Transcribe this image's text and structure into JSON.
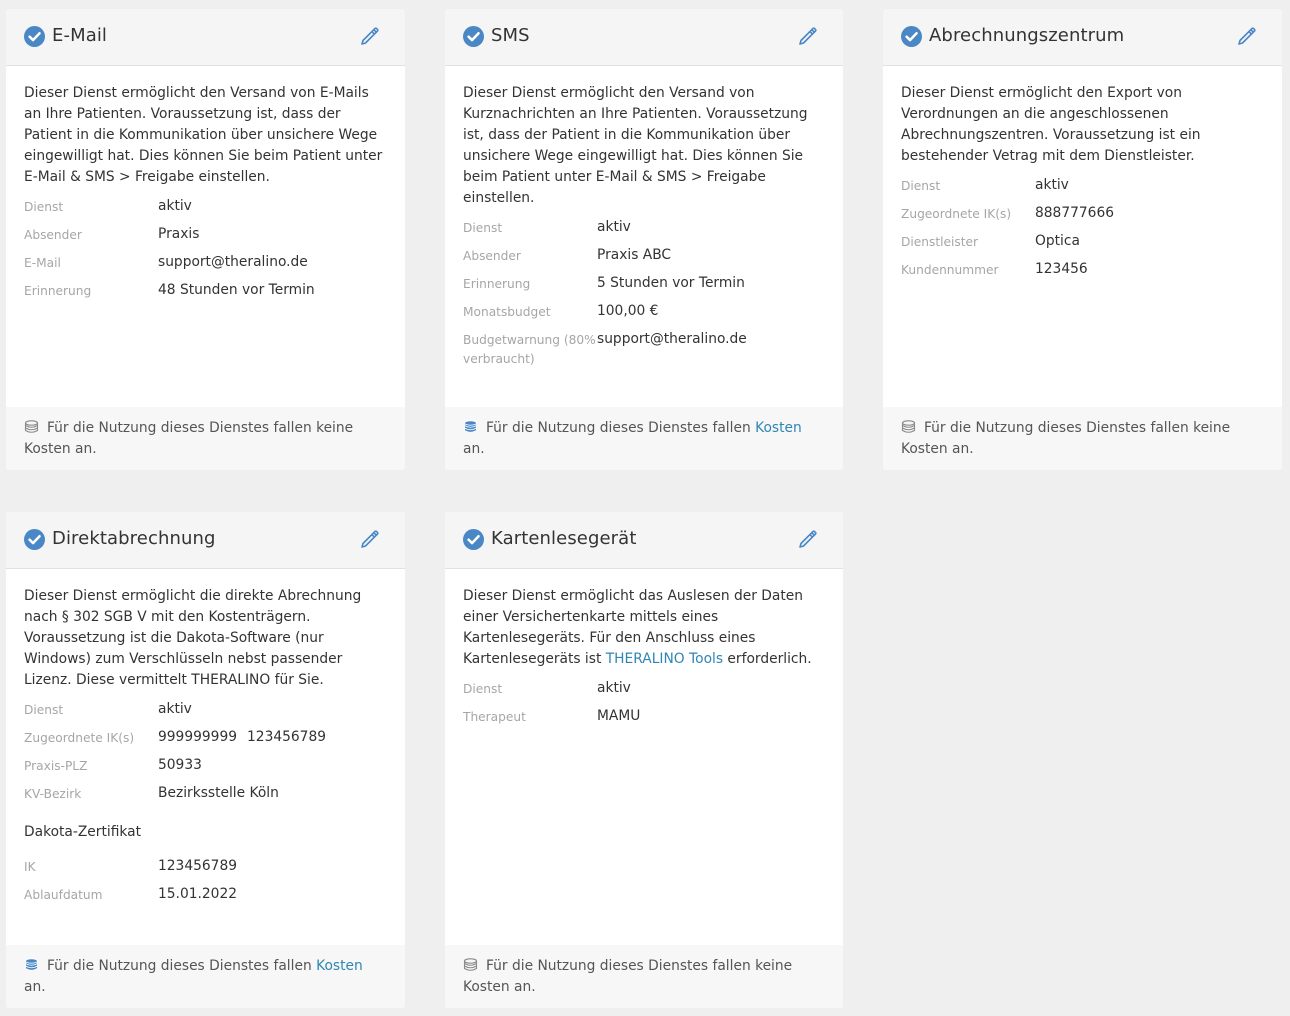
{
  "cards": [
    {
      "title": "E-Mail",
      "description": "Dieser Dienst ermöglicht den Versand von E-Mails an Ihre Patienten. Voraussetzung ist, dass der Patient in die Kommunikation über unsichere Wege eingewilligt hat. Dies können Sie beim Patient unter E-Mail & SMS > Freigabe einstellen.",
      "props": [
        {
          "label": "Dienst",
          "value": "aktiv"
        },
        {
          "label": "Absender",
          "value": "Praxis"
        },
        {
          "label": "E-Mail",
          "value": "support@theralino.de"
        },
        {
          "label": "Erinnerung",
          "value": "48 Stunden vor Termin"
        }
      ],
      "footer": "Für die Nutzung dieses Dienstes fallen keine Kosten an."
    },
    {
      "title": "SMS",
      "description": "Dieser Dienst ermöglicht den Versand von Kurznachrichten an Ihre Patienten. Voraussetzung ist, dass der Patient in die Kommunikation über unsichere Wege eingewilligt hat. Dies können Sie beim Patient unter E-Mail & SMS > Freigabe einstellen.",
      "props": [
        {
          "label": "Dienst",
          "value": "aktiv"
        },
        {
          "label": "Absender",
          "value": "Praxis ABC"
        },
        {
          "label": "Erinnerung",
          "value": "5 Stunden vor Termin"
        },
        {
          "label": "Monatsbudget",
          "value": "100,00 €"
        },
        {
          "label": "Budgetwarnung (80% verbraucht)",
          "value": "support@theralino.de"
        }
      ],
      "footer_pre": "Für die Nutzung dieses Dienstes fallen ",
      "footer_link": "Kosten",
      "footer_post": " an."
    },
    {
      "title": "Abrechnungszentrum",
      "description": "Dieser Dienst ermöglicht den Export von Verordnungen an die angeschlossenen Abrechnungszentren. Voraussetzung ist ein bestehender Vetrag mit dem Dienstleister.",
      "props": [
        {
          "label": "Dienst",
          "value": "aktiv"
        },
        {
          "label": "Zugeordnete IK(s)",
          "value": "888777666"
        },
        {
          "label": "Dienstleister",
          "value": "Optica"
        },
        {
          "label": "Kundennummer",
          "value": "123456"
        }
      ],
      "footer": "Für die Nutzung dieses Dienstes fallen keine Kosten an."
    },
    {
      "title": "Direktabrechnung",
      "description": "Dieser Dienst ermöglicht die direkte Abrechnung nach § 302 SGB V mit den Kostenträgern. Voraussetzung ist die Dakota-Software (nur Windows) zum Verschlüsseln nebst passender Lizenz. Diese vermittelt THERALINO für Sie.",
      "props": [
        {
          "label": "Dienst",
          "value": "aktiv"
        },
        {
          "label": "Zugeordnete IK(s)",
          "values": [
            "999999999",
            "123456789"
          ]
        },
        {
          "label": "Praxis-PLZ",
          "value": "50933"
        },
        {
          "label": "KV-Bezirk",
          "value": "Bezirksstelle Köln"
        }
      ],
      "section_title": "Dakota-Zertifikat",
      "section_props": [
        {
          "label": "IK",
          "value": "123456789"
        },
        {
          "label": "Ablaufdatum",
          "value": "15.01.2022"
        }
      ],
      "footer_pre": "Für die Nutzung dieses Dienstes fallen ",
      "footer_link": "Kosten",
      "footer_post": " an."
    },
    {
      "title": "Kartenlesegerät",
      "desc_pre": "Dieser Dienst ermöglicht das Auslesen der Daten einer Versichertenkarte mittels eines Kartenlesegeräts. Für den Anschluss eines Kartenlesegeräts ist ",
      "desc_link": "THERALINO Tools",
      "desc_post": " erforderlich.",
      "props": [
        {
          "label": "Dienst",
          "value": "aktiv"
        },
        {
          "label": "Therapeut",
          "value": "MAMU"
        }
      ],
      "footer": "Für die Nutzung dieses Dienstes fallen keine Kosten an."
    }
  ],
  "colors": {
    "accent": "#3d7fc1",
    "link": "#2f86b5",
    "background": "#efefef"
  }
}
